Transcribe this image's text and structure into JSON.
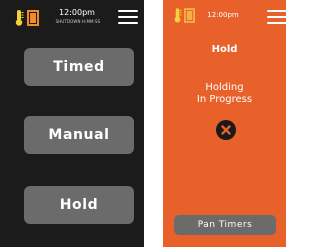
{
  "left_screen": {
    "status": {
      "time": "12:00pm",
      "subtitle": "SHUTDOWN H:MM:SS",
      "icons": [
        "thermometer-icon",
        "door-icon",
        "hamburger-menu-icon"
      ]
    },
    "modes": [
      {
        "label": "Timed"
      },
      {
        "label": "Manual"
      },
      {
        "label": "Hold"
      }
    ]
  },
  "right_screen": {
    "status": {
      "time": "12:00pm",
      "icons": [
        "thermometer-icon",
        "door-icon",
        "hamburger-menu-icon"
      ]
    },
    "title": "Hold",
    "status_text": "Holding\nIn Progress",
    "cancel_icon": "close-icon",
    "footer_button": "Pan Timers"
  },
  "colors": {
    "left_background": "#1b1b1b",
    "button_gray": "#6b6b6b",
    "accent_orange": "#e8602a",
    "icon_yellow": "#f3d23a",
    "icon_orange": "#f08a2a"
  }
}
